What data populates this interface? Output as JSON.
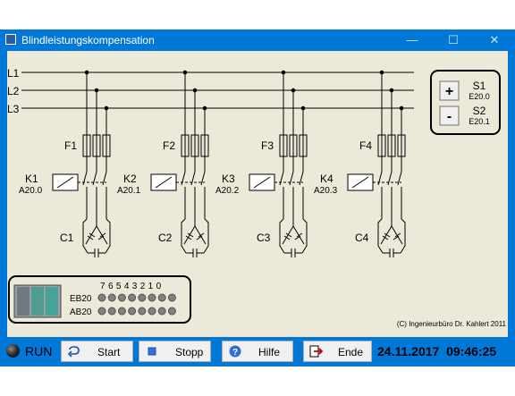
{
  "window": {
    "title": "Blindleistungskompensation",
    "minimize": "—",
    "maximize": "☐",
    "close": "✕"
  },
  "lines": [
    "L1",
    "L2",
    "L3"
  ],
  "groups": [
    {
      "fuse": "F1",
      "contactor": "K1",
      "address": "A20.0",
      "capacitor": "C1"
    },
    {
      "fuse": "F2",
      "contactor": "K2",
      "address": "A20.1",
      "capacitor": "C2"
    },
    {
      "fuse": "F3",
      "contactor": "K3",
      "address": "A20.2",
      "capacitor": "C3"
    },
    {
      "fuse": "F4",
      "contactor": "K4",
      "address": "A20.3",
      "capacitor": "C4"
    }
  ],
  "switches": {
    "plus": {
      "symbol": "+",
      "name": "S1",
      "address": "E20.0"
    },
    "minus": {
      "symbol": "-",
      "name": "S2",
      "address": "E20.1"
    }
  },
  "plc": {
    "bit_header": "7 6 5 4 3 2 1 0",
    "rows": [
      {
        "label": "EB20",
        "bits": [
          0,
          0,
          0,
          0,
          0,
          0,
          0,
          0
        ]
      },
      {
        "label": "AB20",
        "bits": [
          0,
          0,
          0,
          0,
          0,
          0,
          0,
          0
        ]
      }
    ]
  },
  "copyright": "(C) Ingenieurbüro Dr. Kahlert 2011",
  "bottom": {
    "run_label": "RUN",
    "start_label": "Start",
    "stop_label": "Stopp",
    "help_label": "Hilfe",
    "end_label": "Ende",
    "date": "24.11.2017",
    "time": "09:46:25"
  },
  "colors": {
    "titlebar": "#0078d7",
    "client": "#ece9d8",
    "led_off": "#808080"
  }
}
